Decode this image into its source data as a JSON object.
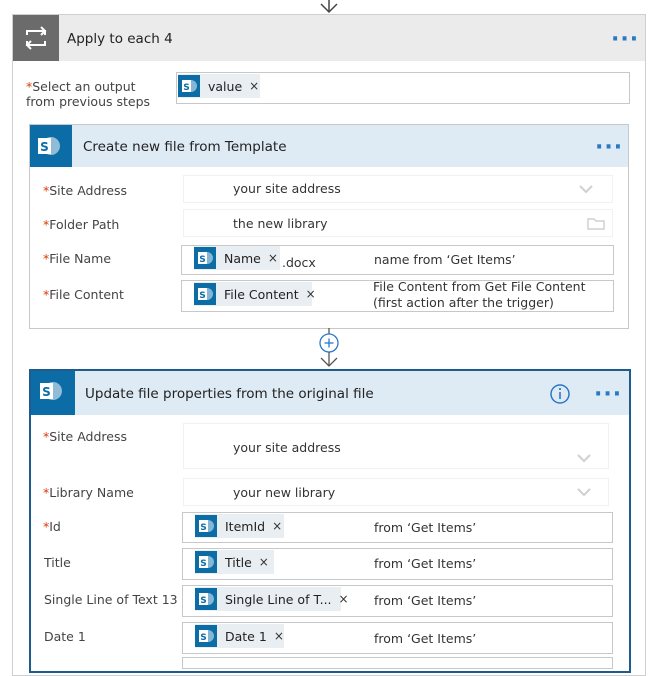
{
  "apply": {
    "title": "Apply to each 4",
    "output_label": "Select an output from previous steps",
    "token": "value"
  },
  "create": {
    "title": "Create new file from Template",
    "site_label": "Site Address",
    "site_value": "your site address",
    "folder_label": "Folder Path",
    "folder_value": "the new library",
    "filename_label": "File Name",
    "filename_token": "Name",
    "filename_suffix": ".docx",
    "filename_note": "name from ‘Get Items’",
    "content_label": "File Content",
    "content_token": "File Content",
    "content_note_1": "File Content from Get File Content",
    "content_note_2": "(first action after the trigger)"
  },
  "update": {
    "title": "Update file properties from the original file",
    "site_label": "Site Address",
    "site_value": "your site address",
    "library_label": "Library Name",
    "library_value": "your new library",
    "rows": [
      {
        "label": "Id",
        "required": true,
        "token": "ItemId",
        "note": "from ‘Get Items’"
      },
      {
        "label": "Title",
        "required": false,
        "token": "Title",
        "note": "from ‘Get Items’"
      },
      {
        "label": "Single Line of Text 13",
        "required": false,
        "token": "Single Line of T...",
        "note": "from ‘Get Items’"
      },
      {
        "label": "Date 1",
        "required": false,
        "token": "Date 1",
        "note": "from ‘Get Items’"
      }
    ]
  },
  "glyphs": {
    "req": "*",
    "x": "×",
    "dots": "···"
  },
  "colors": {
    "accent": "#0b6ca6",
    "header_bg": "#deebf5",
    "loop_header": "#ebebeb",
    "loop_icon_bg": "#6b6b6b",
    "required": "#d83b01"
  }
}
